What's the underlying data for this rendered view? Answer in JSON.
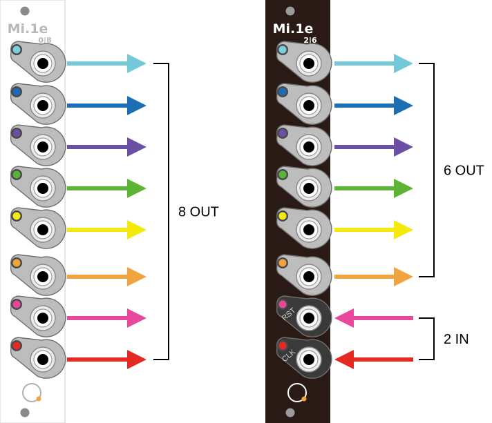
{
  "modules": [
    {
      "logo": "Mi.1e",
      "model": "0|8",
      "panel_color": "#ffffff",
      "jacks": [
        {
          "role": "output",
          "led": "#7ccfdd"
        },
        {
          "role": "output",
          "led": "#1e6bb3"
        },
        {
          "role": "output",
          "led": "#6a4fa3"
        },
        {
          "role": "output",
          "led": "#5ab33a"
        },
        {
          "role": "output",
          "led": "#f5ea14"
        },
        {
          "role": "output",
          "led": "#f0a33e"
        },
        {
          "role": "output",
          "led": "#e8489a"
        },
        {
          "role": "output",
          "led": "#e52a24"
        }
      ],
      "groups": [
        {
          "label": "8 OUT",
          "direction": "out"
        }
      ]
    },
    {
      "logo": "Mi.1e",
      "model": "2|6",
      "panel_color": "#2a1a16",
      "jacks": [
        {
          "role": "output",
          "led": "#7ccfdd"
        },
        {
          "role": "output",
          "led": "#1e6bb3"
        },
        {
          "role": "output",
          "led": "#6a4fa3"
        },
        {
          "role": "output",
          "led": "#5ab33a"
        },
        {
          "role": "output",
          "led": "#f5ea14"
        },
        {
          "role": "output",
          "led": "#f0a33e"
        },
        {
          "role": "input",
          "led": "#e8489a",
          "jack_label": "RST"
        },
        {
          "role": "input",
          "led": "#e52a24",
          "jack_label": "CLK"
        }
      ],
      "groups": [
        {
          "label": "6 OUT",
          "direction": "out"
        },
        {
          "label": "2 IN",
          "direction": "in"
        }
      ]
    }
  ],
  "colors": {
    "arrow_colors": [
      "#74c9d8",
      "#1c6fb4",
      "#6a4fa3",
      "#5db535",
      "#f3ea0c",
      "#f0a33e",
      "#e8489a",
      "#e52a24"
    ],
    "jack_body": "#bdbdbd",
    "bracket": "#000000"
  }
}
